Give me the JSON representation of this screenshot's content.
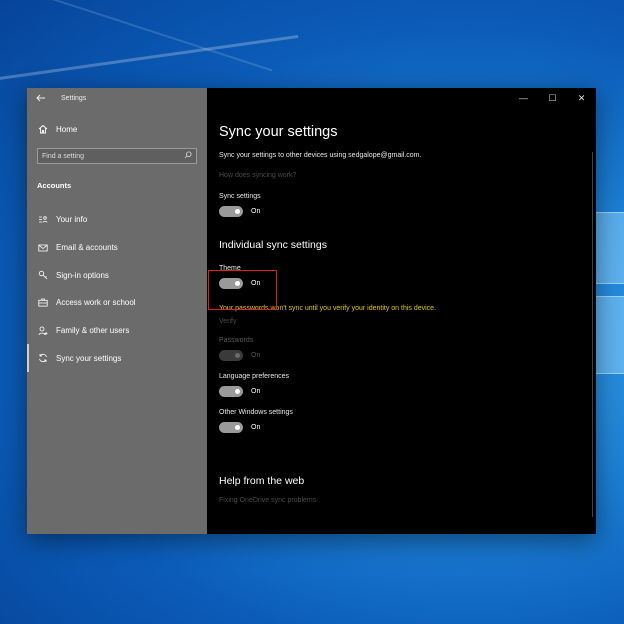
{
  "window": {
    "title": "Settings",
    "controls": {
      "minimize": "—",
      "maximize": "☐",
      "close": "✕"
    }
  },
  "sidebar": {
    "home": "Home",
    "search_placeholder": "Find a setting",
    "section": "Accounts",
    "items": [
      {
        "label": "Your info",
        "icon": "person-card-icon"
      },
      {
        "label": "Email & accounts",
        "icon": "envelope-icon"
      },
      {
        "label": "Sign-in options",
        "icon": "key-icon"
      },
      {
        "label": "Access work or school",
        "icon": "briefcase-icon"
      },
      {
        "label": "Family & other users",
        "icon": "person-add-icon"
      },
      {
        "label": "Sync your settings",
        "icon": "sync-icon",
        "selected": true
      }
    ]
  },
  "main": {
    "title": "Sync your settings",
    "description": "Sync your settings to other devices using sedgalope@gmail.com.",
    "how_link": "How does syncing work?",
    "sync_settings": {
      "label": "Sync settings",
      "state": "On"
    },
    "individual_heading": "Individual sync settings",
    "theme": {
      "label": "Theme",
      "state": "On"
    },
    "warning": "Your passwords won't sync until you verify your identity on this device.",
    "verify": "Verify",
    "passwords": {
      "label": "Passwords",
      "state": "On"
    },
    "language": {
      "label": "Language preferences",
      "state": "On"
    },
    "other": {
      "label": "Other Windows settings",
      "state": "On"
    },
    "help_heading": "Help from the web",
    "help_link": "Fixing OneDrive sync problems"
  },
  "colors": {
    "warning": "#e0c800",
    "highlight": "#e02020",
    "sidebar_bg": "#6b6b6b"
  }
}
